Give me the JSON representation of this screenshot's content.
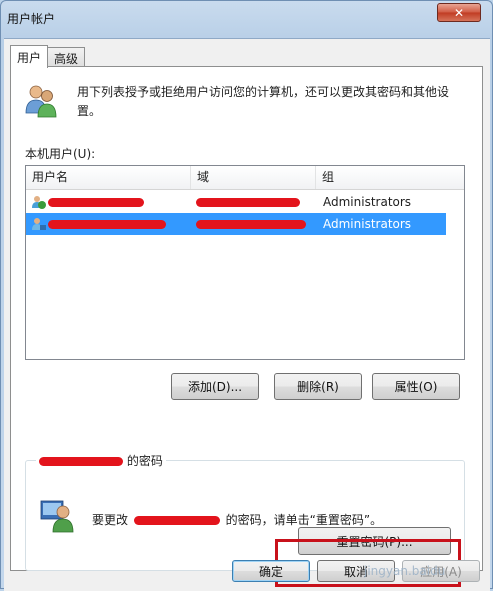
{
  "window": {
    "title": "用户帐户",
    "close_symbol": "✕"
  },
  "tabs": [
    {
      "label": "用户"
    },
    {
      "label": "高级"
    }
  ],
  "intro": {
    "text": "用下列表授予或拒绝用户访问您的计算机，还可以更改其密码和其他设置。"
  },
  "user_list": {
    "label": "本机用户(U):",
    "columns": [
      "用户名",
      "域",
      "组"
    ],
    "rows": [
      {
        "group": "Administrators",
        "selected": false
      },
      {
        "group": "Administrators",
        "selected": true
      }
    ]
  },
  "buttons": {
    "add": "添加(D)...",
    "delete": "删除(R)",
    "properties": "属性(O)"
  },
  "password_group": {
    "title_suffix": "的密码",
    "text_prefix": "要更改",
    "text_suffix": "的密码，请单击“重置密码”。",
    "reset_button": "重置密码(P)..."
  },
  "footer": {
    "ok": "确定",
    "cancel": "取消",
    "apply": "应用(A)"
  },
  "watermark": "jingyan.baidu",
  "colors": {
    "selection": "#3399ff",
    "annotation": "#c8111b",
    "redaction": "#e3141c"
  }
}
